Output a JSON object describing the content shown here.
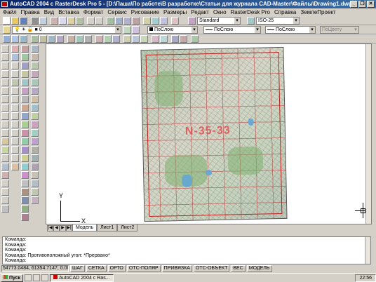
{
  "window": {
    "title": "AutoCAD 2004 с RasterDesk Pro 5 - [D:\\Паша\\По работе\\В разработке\\Статьи для журнала CAD-Master\\Файлы\\Drawing1.dwg]"
  },
  "menu": [
    "Файл",
    "Правка",
    "Вид",
    "Вставка",
    "Формат",
    "Сервис",
    "Рисование",
    "Размеры",
    "Редакт",
    "Окно",
    "RasterDesk Pro",
    "Справка",
    "ЗемлеПроект"
  ],
  "toolbar2": {
    "text_style": "Standard",
    "dim_style": "ISO-25"
  },
  "toolbar3": {
    "layer": "0",
    "color": "ПоСлою",
    "linetype": "ПоСлою",
    "lineweight": "ПоСлою",
    "plotstyle": "ПоЦвету"
  },
  "map": {
    "label": "N-35-33"
  },
  "ucs": {
    "x": "X",
    "y": "Y"
  },
  "tabs": {
    "nav": [
      "|◀",
      "◀",
      "▶",
      "▶|"
    ],
    "model": "Модель",
    "sheet1": "Лист1",
    "sheet2": "Лист2"
  },
  "command_lines": [
    "Команда:",
    "Команда:",
    "Команда:",
    "Команда:  Противоположный угол: *Прервано*",
    "Команда:"
  ],
  "status": {
    "coords": "54773.0484, 61354.7147, 0.0000",
    "buttons": [
      "ШАГ",
      "СЕТКА",
      "ОРТО",
      "ОТС-ПОЛЯР",
      "ПРИВЯЗКА",
      "ОТС-ОБЪЕКТ",
      "ВЕС",
      "МОДЕЛЬ"
    ]
  },
  "taskbar": {
    "start": "Пуск",
    "task": "AutoCAD 2004 с Ras...",
    "time": "22:56"
  },
  "colors": {
    "titlebar": "#0a246a",
    "map_grid": "#c02020",
    "lake": "#5ea5d8"
  }
}
